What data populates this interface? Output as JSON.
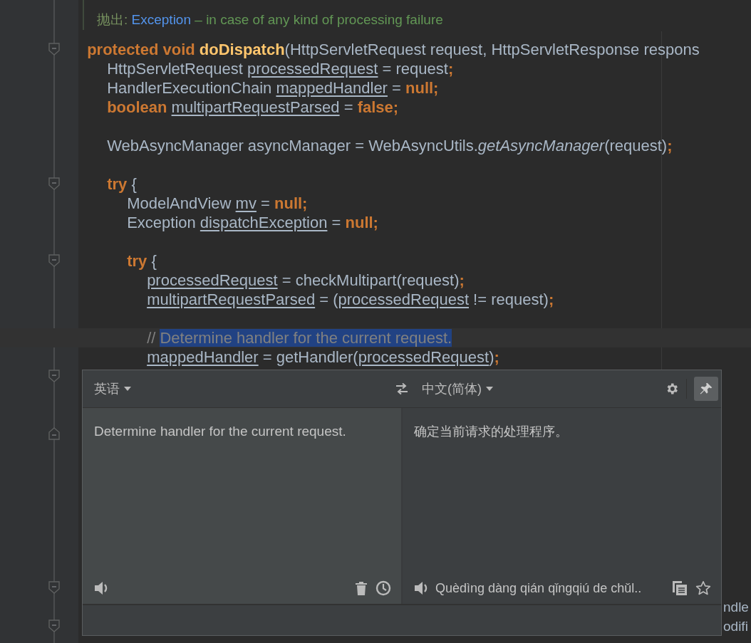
{
  "doc": [
    {
      "parts": [
        {
          "text": "抛出: ",
          "kind": "tag"
        },
        {
          "text": "Exception",
          "kind": "link"
        },
        {
          "text": " – in case of any kind of processing failure",
          "kind": "doc"
        }
      ]
    }
  ],
  "code": [
    {
      "kind": "opener",
      "current": false,
      "tokens": [
        {
          "text": "protected void ",
          "kind": "kw"
        },
        {
          "text": "doDispatch",
          "kind": "fn"
        },
        {
          "text": "(HttpServletRequest request, HttpServletResponse respons",
          "kind": "plain"
        }
      ],
      "children": [
        {
          "kind": "plain",
          "current": false,
          "tokens": [
            {
              "text": "HttpServletRequest ",
              "kind": "plain"
            },
            {
              "text": "processedRequest",
              "kind": "var"
            },
            {
              "text": " = request",
              "kind": "plain"
            },
            {
              "text": ";",
              "kind": "kw"
            }
          ]
        },
        {
          "kind": "plain",
          "current": false,
          "tokens": [
            {
              "text": "HandlerExecutionChain ",
              "kind": "plain"
            },
            {
              "text": "mappedHandler",
              "kind": "var"
            },
            {
              "text": " = ",
              "kind": "plain"
            },
            {
              "text": "null;",
              "kind": "kw"
            }
          ]
        },
        {
          "kind": "plain",
          "current": false,
          "tokens": [
            {
              "text": "boolean ",
              "kind": "kw"
            },
            {
              "text": "multipartRequestParsed",
              "kind": "var"
            },
            {
              "text": " = ",
              "kind": "plain"
            },
            {
              "text": "false;",
              "kind": "kw"
            }
          ]
        },
        {
          "kind": "plain",
          "current": false
        },
        {
          "kind": "plain",
          "current": false,
          "tokens": [
            {
              "text": "WebAsyncManager asyncManager = WebAsyncUtils.",
              "kind": "plain"
            },
            {
              "text": "getAsyncManager",
              "kind": "static"
            },
            {
              "text": "(request)",
              "kind": "plain"
            },
            {
              "text": ";",
              "kind": "kw"
            }
          ]
        },
        {
          "kind": "plain",
          "current": false
        },
        {
          "kind": "opener",
          "current": false,
          "tokens": [
            {
              "text": "try ",
              "kind": "kw"
            },
            {
              "text": "{",
              "kind": "plain"
            }
          ],
          "children": [
            {
              "kind": "plain",
              "current": false,
              "tokens": [
                {
                  "text": "ModelAndView ",
                  "kind": "plain"
                },
                {
                  "text": "mv",
                  "kind": "var"
                },
                {
                  "text": " = ",
                  "kind": "plain"
                },
                {
                  "text": "null;",
                  "kind": "kw"
                }
              ]
            },
            {
              "kind": "plain",
              "current": false,
              "tokens": [
                {
                  "text": "Exception ",
                  "kind": "plain"
                },
                {
                  "text": "dispatchException",
                  "kind": "var"
                },
                {
                  "text": " = ",
                  "kind": "plain"
                },
                {
                  "text": "null;",
                  "kind": "kw"
                }
              ]
            },
            {
              "kind": "plain",
              "current": false
            },
            {
              "kind": "opener",
              "current": false,
              "tokens": [
                {
                  "text": "try ",
                  "kind": "kw"
                },
                {
                  "text": "{",
                  "kind": "plain"
                }
              ],
              "children": [
                {
                  "kind": "plain",
                  "current": false,
                  "tokens": [
                    {
                      "text": "processedRequest",
                      "kind": "var"
                    },
                    {
                      "text": " = checkMultipart(request)",
                      "kind": "plain"
                    },
                    {
                      "text": ";",
                      "kind": "kw"
                    }
                  ]
                },
                {
                  "kind": "plain",
                  "current": false,
                  "tokens": [
                    {
                      "text": "multipartRequestParsed",
                      "kind": "var"
                    },
                    {
                      "text": " = (",
                      "kind": "plain"
                    },
                    {
                      "text": "processedRequest",
                      "kind": "var"
                    },
                    {
                      "text": " != request)",
                      "kind": "plain"
                    },
                    {
                      "text": ";",
                      "kind": "kw"
                    }
                  ]
                },
                {
                  "kind": "plain",
                  "current": false
                },
                {
                  "kind": "plain",
                  "current": true,
                  "tokens": [
                    {
                      "text": "// ",
                      "kind": "comment"
                    },
                    {
                      "text": "Determine handler for the current request.",
                      "kind": "selected"
                    }
                  ]
                },
                {
                  "kind": "plain",
                  "current": false,
                  "tokens": [
                    {
                      "text": "mappedHandler",
                      "kind": "var"
                    },
                    {
                      "text": " = getHandler(",
                      "kind": "plain"
                    },
                    {
                      "text": "processedRequest",
                      "kind": "var"
                    },
                    {
                      "text": ")",
                      "kind": "plain"
                    },
                    {
                      "text": ";",
                      "kind": "kw"
                    }
                  ]
                },
                {
                  "kind": "opener",
                  "current": false
                },
                {
                  "kind": "plain",
                  "current": false
                },
                {
                  "kind": "plain",
                  "current": false
                },
                {
                  "kind": "closer",
                  "current": false
                },
                {
                  "kind": "plain",
                  "current": false
                },
                {
                  "kind": "plain",
                  "current": false
                },
                {
                  "kind": "plain",
                  "current": false
                },
                {
                  "kind": "plain",
                  "current": false
                },
                {
                  "kind": "plain",
                  "current": false
                },
                {
                  "kind": "plain",
                  "current": false
                },
                {
                  "kind": "plain",
                  "current": false
                },
                {
                  "kind": "opener",
                  "current": false,
                  "children": [
                    {
                      "kind": "plain",
                      "current": false,
                      "tail": "ndle"
                    },
                    {
                      "kind": "opener",
                      "current": false,
                      "tail": "odifi"
                    }
                  ]
                }
              ]
            }
          ]
        }
      ]
    }
  ],
  "translator": {
    "source_language": "英语",
    "target_language": "中文(简体)",
    "pinned": true,
    "source_text": "Determine handler for the current request.",
    "translation": "确定当前请求的处理程序。",
    "transliteration": "Quèdìng dàng qián qǐngqiú de chǔl.."
  }
}
